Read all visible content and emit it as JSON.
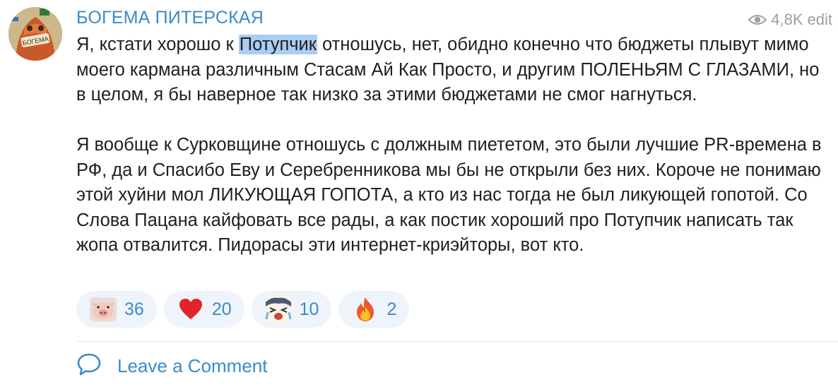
{
  "channel": {
    "name": "БОГЕМА ПИТЕРСКАЯ",
    "avatar_text": "БОГЕМА"
  },
  "views": {
    "count": "4,8K",
    "edited_label": "edit"
  },
  "message": {
    "p1_before": "Я, кстати хорошо к ",
    "p1_highlight": "Потупчик",
    "p1_after": " отношусь, нет, обидно конечно что бюджеты плывут мимо моего кармана различным Стасам Ай Как Просто, и другим ПОЛЕНЬЯМ С ГЛАЗАМИ, но в целом, я бы наверное так низко за этими бюджетами не смог нагнуться.",
    "p2": "Я вообще к Сурковщине отношусь с должным пиететом, это были лучшие PR-времена в РФ, да и Спасибо Еву и Серебренникова мы бы не открыли без них. Короче не понимаю этой хуйни мол ЛИКУЮЩАЯ ГОПОТА, а кто из нас тогда не был ликующей гопотой. Со Слова Пацана кайфовать все рады, а как постик хороший про Потупчик написать так жопа отвалится. Пидорасы эти интернет-криэйторы, вот кто."
  },
  "reactions": [
    {
      "emoji": "pig-face",
      "count": "36"
    },
    {
      "emoji": "red-heart",
      "count": "20"
    },
    {
      "emoji": "crying-anime-face",
      "count": "10"
    },
    {
      "emoji": "fire",
      "count": "2"
    }
  ],
  "comment": {
    "label": "Leave a Comment"
  },
  "colors": {
    "accent": "#3a8bc8",
    "highlight": "#a9cdf3",
    "reaction_bg": "#eef4f9",
    "muted": "#9aa0a6"
  }
}
